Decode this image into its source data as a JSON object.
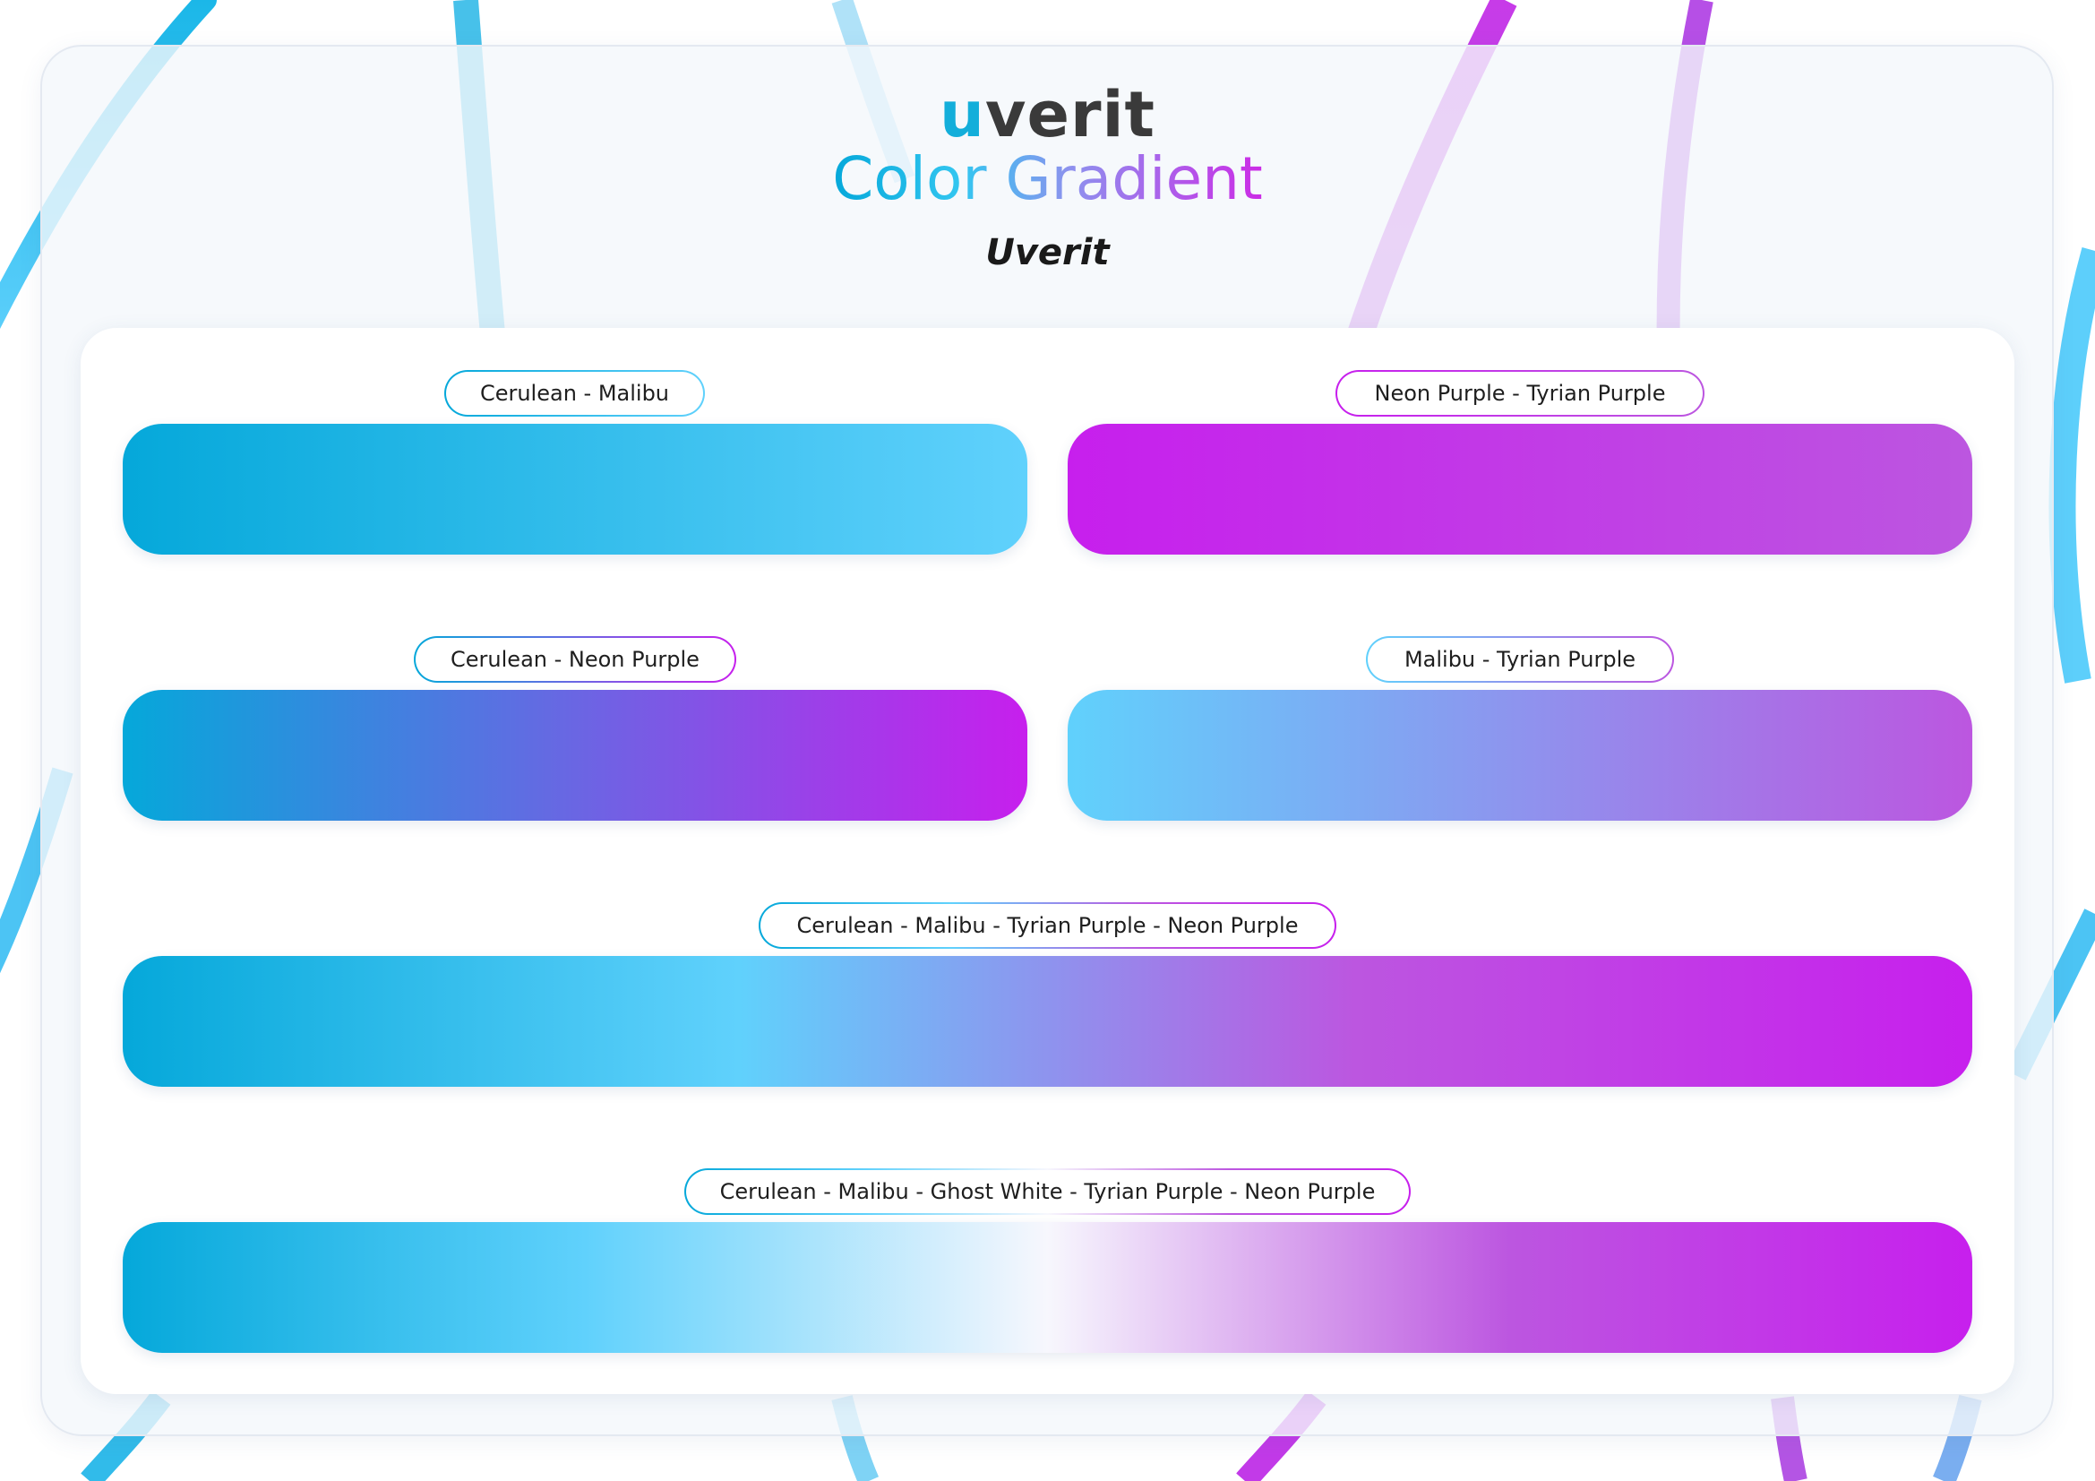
{
  "brand": {
    "initial": "u",
    "rest": "verit"
  },
  "title": "Color Gradient",
  "subtitle": "Uverit",
  "gradients": [
    {
      "label": "Cerulean - Malibu",
      "stops": [
        "#05a8da",
        "#60d1fc"
      ]
    },
    {
      "label": "Neon Purple - Tyrian Purple",
      "stops": [
        "#c71fed",
        "#bc56e0"
      ]
    },
    {
      "label": "Cerulean - Neon Purple",
      "stops": [
        "#05a8da",
        "#6a66e3",
        "#c71fed"
      ]
    },
    {
      "label": "Malibu - Tyrian Purple",
      "stops": [
        "#60d1fc",
        "#bc56e0"
      ]
    },
    {
      "label": "Cerulean - Malibu - Tyrian Purple - Neon Purple",
      "stops": [
        "#05a8da",
        "#60d1fc",
        "#bc56e0",
        "#c71fed"
      ]
    },
    {
      "label": "Cerulean - Malibu - Ghost White - Tyrian Purple - Neon Purple",
      "stops": [
        "#05a8da",
        "#60d1fc",
        "#f7f7fd",
        "#bc56e0",
        "#c71fed"
      ]
    }
  ]
}
